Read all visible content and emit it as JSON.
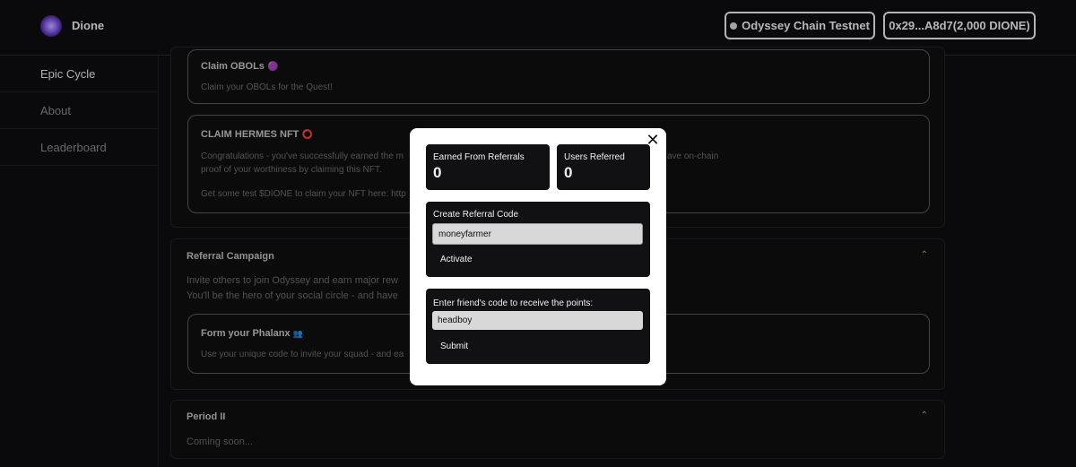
{
  "header": {
    "brand": "Dione",
    "chain_button": "Odyssey Chain Testnet",
    "wallet_button": "0x29...A8d7(2,000 DIONE)"
  },
  "sidebar": {
    "items": [
      {
        "label": "Epic Cycle"
      },
      {
        "label": "About"
      },
      {
        "label": "Leaderboard"
      }
    ]
  },
  "main": {
    "claim_obols": {
      "title": "Claim OBOLs",
      "emoji": "🟣",
      "text": "Claim your OBOLs for the Quest!"
    },
    "claim_hermes": {
      "title": "CLAIM HERMES NFT",
      "emoji": "⭕",
      "line1_left": "Congratulations - you've successfully earned the m",
      "line1_right": "ave on-chain",
      "line2": "proof of your worthiness by claiming this NFT.",
      "line3": "Get some test $DIONE to claim your NFT here: http"
    },
    "referral_campaign": {
      "title": "Referral Campaign",
      "chevron": "⌃",
      "line1": "Invite others to join Odyssey and earn major rew",
      "line2": "You'll be the hero of your social circle - and have"
    },
    "phalanx": {
      "title": "Form your Phalanx",
      "emoji": "👥",
      "text": "Use your unique code to invite your squad - and ea"
    },
    "period2": {
      "title": "Period II",
      "chevron": "⌃",
      "text": "Coming soon..."
    }
  },
  "modal": {
    "close": "✕",
    "earned_label": "Earned From Referrals",
    "earned_value": "0",
    "users_label": "Users Referred",
    "users_value": "0",
    "create_label": "Create Referral Code",
    "create_value": "moneyfarmer",
    "activate_label": "Activate",
    "friend_label": "Enter friend's code to receive the points:",
    "friend_value": "headboy",
    "submit_label": "Submit"
  }
}
